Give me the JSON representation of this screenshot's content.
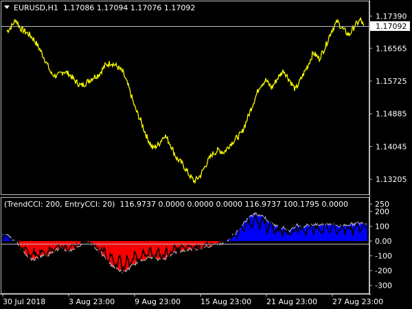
{
  "window": {
    "symbol_label": "EURUSD,H1  1.17086 1.17094 1.17076 1.17092"
  },
  "colors": {
    "background": "#000000",
    "price_line": "#ffff00",
    "bid_line": "#c0c0c0",
    "bull_histogram": "#0000ff",
    "bear_histogram": "#ff0000",
    "trend_cci_outline": "#c0c0c0",
    "entry_cci_line": "#000000",
    "frame": "#c0c0c0",
    "text": "#ffffff",
    "bid_tag_bg": "#ffffff",
    "bid_tag_text": "#000000"
  },
  "price_axis": {
    "ticks": [
      "1.17390",
      "1.16565",
      "1.15725",
      "1.14885",
      "1.14045",
      "1.13205"
    ],
    "tick_values": [
      1.1739,
      1.16565,
      1.15725,
      1.14885,
      1.14045,
      1.13205
    ],
    "current_bid": "1.17092",
    "current_bid_value": 1.17092
  },
  "indicator": {
    "label": "(TrendCCI: 200, EntryCCI: 20)  116.9737 0.0000 0.0000 0.0000 116.9737 100.1795 0.0000",
    "ticks": [
      "250",
      "200",
      "100",
      "0.00",
      "-100",
      "-200",
      "-300"
    ],
    "tick_values": [
      250,
      200,
      100,
      0,
      -100,
      -200,
      -300
    ]
  },
  "time_axis": {
    "labels": [
      "30 Jul 2018",
      "3 Aug 23:00",
      "9 Aug 23:00",
      "15 Aug 23:00",
      "21 Aug 23:00",
      "27 Aug 23:00"
    ]
  },
  "chart_data": {
    "type": "line",
    "price_series_keypoints": [
      [
        0,
        1.17
      ],
      [
        3,
        1.1712
      ],
      [
        6,
        1.173
      ],
      [
        9,
        1.1708
      ],
      [
        12,
        1.17
      ],
      [
        15,
        1.1692
      ],
      [
        18,
        1.168
      ],
      [
        22,
        1.1655
      ],
      [
        26,
        1.1625
      ],
      [
        30,
        1.159
      ],
      [
        34,
        1.1585
      ],
      [
        38,
        1.1598
      ],
      [
        42,
        1.159
      ],
      [
        46,
        1.1572
      ],
      [
        50,
        1.156
      ],
      [
        54,
        1.157
      ],
      [
        58,
        1.1582
      ],
      [
        62,
        1.159
      ],
      [
        66,
        1.1612
      ],
      [
        70,
        1.162
      ],
      [
        74,
        1.161
      ],
      [
        78,
        1.1595
      ],
      [
        82,
        1.1555
      ],
      [
        86,
        1.1505
      ],
      [
        90,
        1.147
      ],
      [
        94,
        1.143
      ],
      [
        98,
        1.14
      ],
      [
        102,
        1.141
      ],
      [
        106,
        1.1435
      ],
      [
        110,
        1.141
      ],
      [
        114,
        1.1375
      ],
      [
        118,
        1.136
      ],
      [
        122,
        1.1335
      ],
      [
        126,
        1.1315
      ],
      [
        130,
        1.133
      ],
      [
        134,
        1.136
      ],
      [
        138,
        1.1385
      ],
      [
        142,
        1.1395
      ],
      [
        146,
        1.139
      ],
      [
        150,
        1.141
      ],
      [
        154,
        1.1425
      ],
      [
        158,
        1.144
      ],
      [
        162,
        1.148
      ],
      [
        166,
        1.152
      ],
      [
        170,
        1.156
      ],
      [
        174,
        1.1575
      ],
      [
        178,
        1.1555
      ],
      [
        182,
        1.158
      ],
      [
        186,
        1.16
      ],
      [
        190,
        1.1575
      ],
      [
        194,
        1.155
      ],
      [
        198,
        1.158
      ],
      [
        202,
        1.161
      ],
      [
        206,
        1.1645
      ],
      [
        210,
        1.163
      ],
      [
        214,
        1.166
      ],
      [
        218,
        1.17
      ],
      [
        222,
        1.1725
      ],
      [
        226,
        1.1705
      ],
      [
        230,
        1.169
      ],
      [
        234,
        1.1715
      ],
      [
        238,
        1.173
      ],
      [
        240,
        1.1709
      ]
    ],
    "cci_series_keypoints": [
      [
        0,
        40
      ],
      [
        3,
        50
      ],
      [
        6,
        10
      ],
      [
        8,
        -5
      ],
      [
        10,
        -40
      ],
      [
        14,
        -110
      ],
      [
        18,
        -125
      ],
      [
        22,
        -100
      ],
      [
        26,
        -95
      ],
      [
        30,
        -60
      ],
      [
        34,
        -55
      ],
      [
        38,
        -70
      ],
      [
        42,
        -45
      ],
      [
        46,
        -20
      ],
      [
        48,
        -5
      ],
      [
        50,
        -10
      ],
      [
        54,
        -50
      ],
      [
        58,
        -100
      ],
      [
        62,
        -155
      ],
      [
        66,
        -190
      ],
      [
        70,
        -210
      ],
      [
        74,
        -175
      ],
      [
        78,
        -140
      ],
      [
        82,
        -120
      ],
      [
        86,
        -110
      ],
      [
        90,
        -130
      ],
      [
        94,
        -115
      ],
      [
        98,
        -80
      ],
      [
        102,
        -70
      ],
      [
        106,
        -60
      ],
      [
        110,
        -55
      ],
      [
        114,
        -50
      ],
      [
        118,
        -40
      ],
      [
        122,
        -30
      ],
      [
        126,
        -15
      ],
      [
        128,
        -5
      ],
      [
        130,
        10
      ],
      [
        134,
        50
      ],
      [
        138,
        100
      ],
      [
        142,
        160
      ],
      [
        146,
        185
      ],
      [
        150,
        170
      ],
      [
        154,
        130
      ],
      [
        158,
        100
      ],
      [
        162,
        90
      ],
      [
        166,
        70
      ],
      [
        170,
        110
      ],
      [
        174,
        100
      ],
      [
        178,
        115
      ],
      [
        182,
        105
      ],
      [
        186,
        115
      ],
      [
        190,
        120
      ],
      [
        194,
        100
      ],
      [
        198,
        110
      ],
      [
        202,
        115
      ],
      [
        206,
        120
      ],
      [
        210,
        117
      ]
    ],
    "ylim": [
      1.1305,
      1.1745
    ],
    "cci_ylim": [
      -320,
      260
    ],
    "grid": false
  }
}
